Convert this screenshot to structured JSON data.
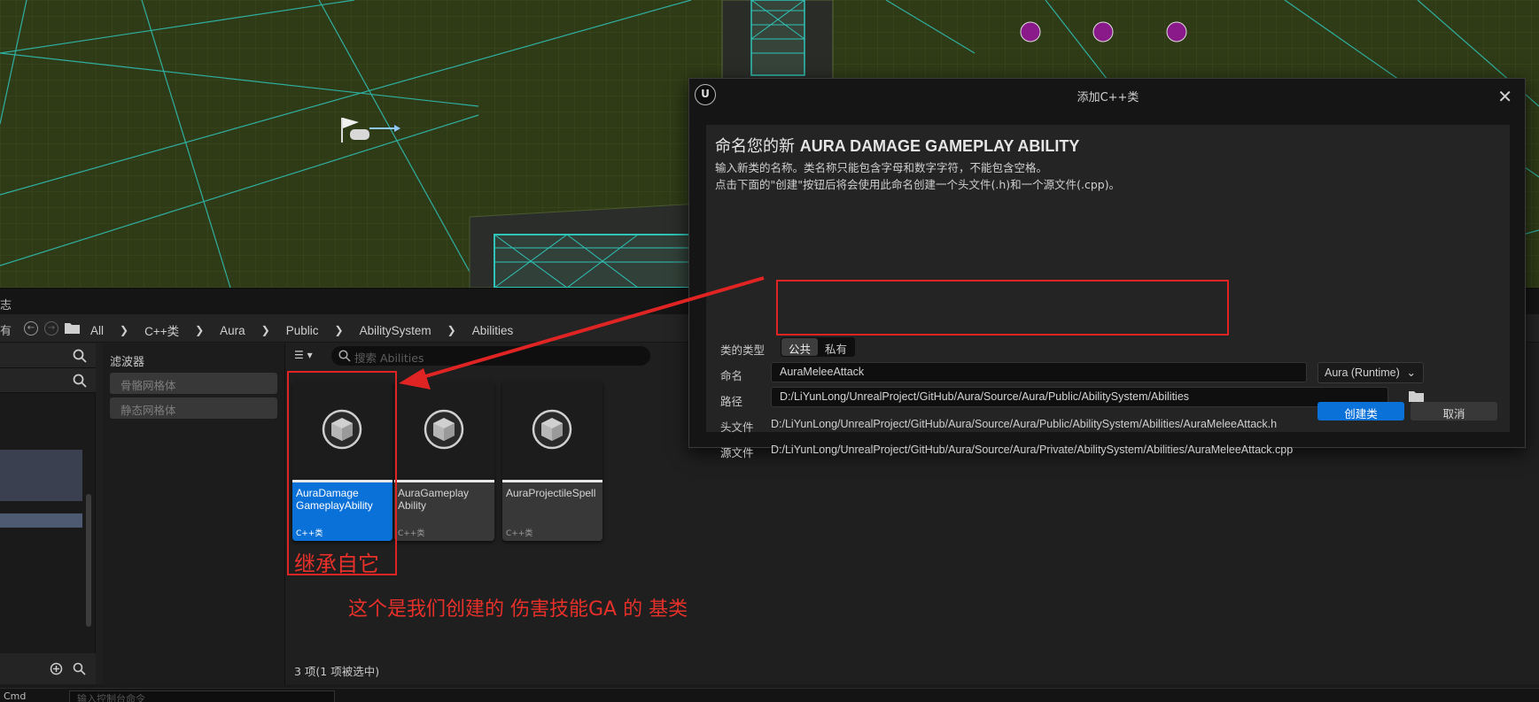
{
  "log": {
    "title_fragment": "志"
  },
  "content_browser": {
    "nav_fragment": "有",
    "breadcrumb": [
      "All",
      "C++类",
      "Aura",
      "Public",
      "AbilitySystem",
      "Abilities"
    ],
    "filters": {
      "title": "滤波器",
      "items": [
        "骨骼网格体",
        "静态网格体"
      ]
    },
    "search_placeholder": "搜索 Abilities",
    "assets": [
      {
        "name": "AuraDamage GameplayAbility",
        "type": "C++类",
        "selected": true
      },
      {
        "name": "AuraGameplay Ability",
        "type": "C++类",
        "selected": false
      },
      {
        "name": "AuraProjectileSpell",
        "type": "C++类",
        "selected": false
      }
    ],
    "status": "3 项(1 项被选中)",
    "console": {
      "cmd": "Cmd",
      "placeholder": "输入控制台命令"
    }
  },
  "dialog": {
    "title": "添加C++类",
    "heading_prefix": "命名您的新",
    "heading_class": "AURA DAMAGE GAMEPLAY ABILITY",
    "desc1": "输入新类的名称。类名称只能包含字母和数字字符，不能包含空格。",
    "desc2": "点击下面的\"创建\"按钮后将会使用此命名创建一个头文件(.h)和一个源文件(.cpp)。",
    "type_label": "类的类型",
    "type_tabs": [
      "公共",
      "私有"
    ],
    "name_label": "命名",
    "name_value": "AuraMeleeAttack",
    "module": "Aura (Runtime)",
    "path_label": "路径",
    "path_value": "D:/LiYunLong/UnrealProject/GitHub/Aura/Source/Aura/Public/AbilitySystem/Abilities",
    "header_label": "头文件",
    "header_value": "D:/LiYunLong/UnrealProject/GitHub/Aura/Source/Aura/Public/AbilitySystem/Abilities/AuraMeleeAttack.h",
    "source_label": "源文件",
    "source_value": "D:/LiYunLong/UnrealProject/GitHub/Aura/Source/Aura/Private/AbilitySystem/Abilities/AuraMeleeAttack.cpp",
    "create_label": "创建类",
    "cancel_label": "取消"
  },
  "annotations": {
    "inherit_note": "继承自它",
    "base_class_note": "这个是我们创建的 伤害技能GA 的 基类",
    "color": "#e02424"
  }
}
